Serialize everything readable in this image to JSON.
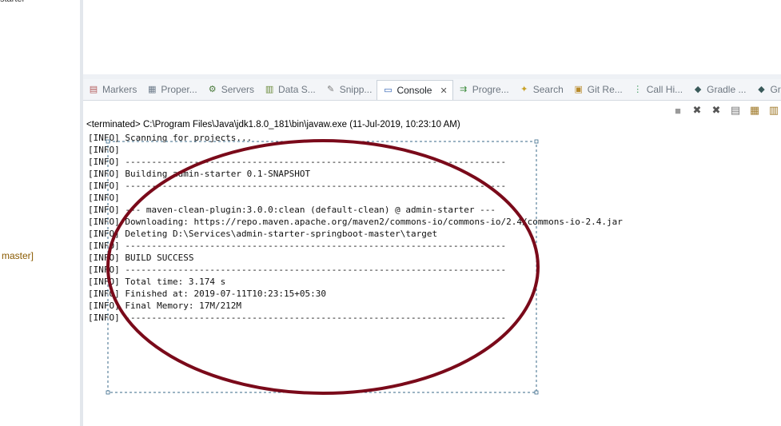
{
  "left_pane": {
    "top_text": "starter",
    "branch_text": "master]"
  },
  "tabs": [
    {
      "label": "Markers",
      "icon": "markers-icon",
      "glyph": "▤",
      "color": "#b35a5a",
      "active": false
    },
    {
      "label": "Proper...",
      "icon": "properties-icon",
      "glyph": "▦",
      "color": "#6d7b8a",
      "active": false
    },
    {
      "label": "Servers",
      "icon": "servers-icon",
      "glyph": "⚙",
      "color": "#4a7a3c",
      "active": false
    },
    {
      "label": "Data S...",
      "icon": "data-source-icon",
      "glyph": "▥",
      "color": "#6a8a3a",
      "active": false
    },
    {
      "label": "Snipp...",
      "icon": "snippets-icon",
      "glyph": "✎",
      "color": "#7a7a7a",
      "active": false
    },
    {
      "label": "Console",
      "icon": "console-icon",
      "glyph": "▭",
      "color": "#2a5db0",
      "active": true,
      "close": "✕"
    },
    {
      "label": "Progre...",
      "icon": "progress-icon",
      "glyph": "⇉",
      "color": "#3a8a3a",
      "active": false
    },
    {
      "label": "Search",
      "icon": "search-icon",
      "glyph": "✦",
      "color": "#c9a227",
      "active": false
    },
    {
      "label": "Git Re...",
      "icon": "git-repositories-icon",
      "glyph": "▣",
      "color": "#b88a2a",
      "active": false
    },
    {
      "label": "Call Hi...",
      "icon": "call-hierarchy-icon",
      "glyph": "⋮",
      "color": "#3a9a5a",
      "active": false
    },
    {
      "label": "Gradle ...",
      "icon": "gradle-tasks-icon",
      "glyph": "◆",
      "color": "#3a5a5a",
      "active": false
    },
    {
      "label": "Gradle",
      "icon": "gradle-executions-icon",
      "glyph": "◆",
      "color": "#3a5a5a",
      "active": false
    }
  ],
  "toolbar": [
    {
      "icon": "terminate-icon",
      "glyph": "■",
      "color": "#9a9a9a"
    },
    {
      "icon": "remove-launch-icon",
      "glyph": "✖",
      "color": "#555555"
    },
    {
      "icon": "remove-all-terminated-icon",
      "glyph": "✖",
      "color": "#555555"
    },
    {
      "icon": "clear-console-icon",
      "glyph": "▤",
      "color": "#777777"
    },
    {
      "icon": "scroll-lock-icon",
      "glyph": "▦",
      "color": "#a07a2a"
    },
    {
      "icon": "word-wrap-icon",
      "glyph": "▥",
      "color": "#a07a2a"
    }
  ],
  "console": {
    "status": "<terminated> C:\\Program Files\\Java\\jdk1.8.0_181\\bin\\javaw.exe (11-Jul-2019, 10:23:10 AM)",
    "lines": [
      "[INFO] Scanning for projects...",
      "[INFO]",
      "[INFO] ------------------------------------------------------------------------",
      "[INFO] Building admin-starter 0.1-SNAPSHOT",
      "[INFO] ------------------------------------------------------------------------",
      "[INFO]",
      "[INFO] --- maven-clean-plugin:3.0.0:clean (default-clean) @ admin-starter ---",
      "[INFO] Downloading: https://repo.maven.apache.org/maven2/commons-io/commons-io/2.4/commons-io-2.4.jar",
      "[INFO] Deleting D:\\Services\\admin-starter-springboot-master\\target",
      "[INFO] ------------------------------------------------------------------------",
      "[INFO] BUILD SUCCESS",
      "[INFO] ------------------------------------------------------------------------",
      "[INFO] Total time: 3.174 s",
      "[INFO] Finished at: 2019-07-11T10:23:15+05:30",
      "[INFO] Final Memory: 17M/212M",
      "[INFO] ------------------------------------------------------------------------"
    ]
  },
  "annotation": {
    "ellipse_color": "#7a0a1a",
    "selection_color": "#3a6a8a"
  }
}
